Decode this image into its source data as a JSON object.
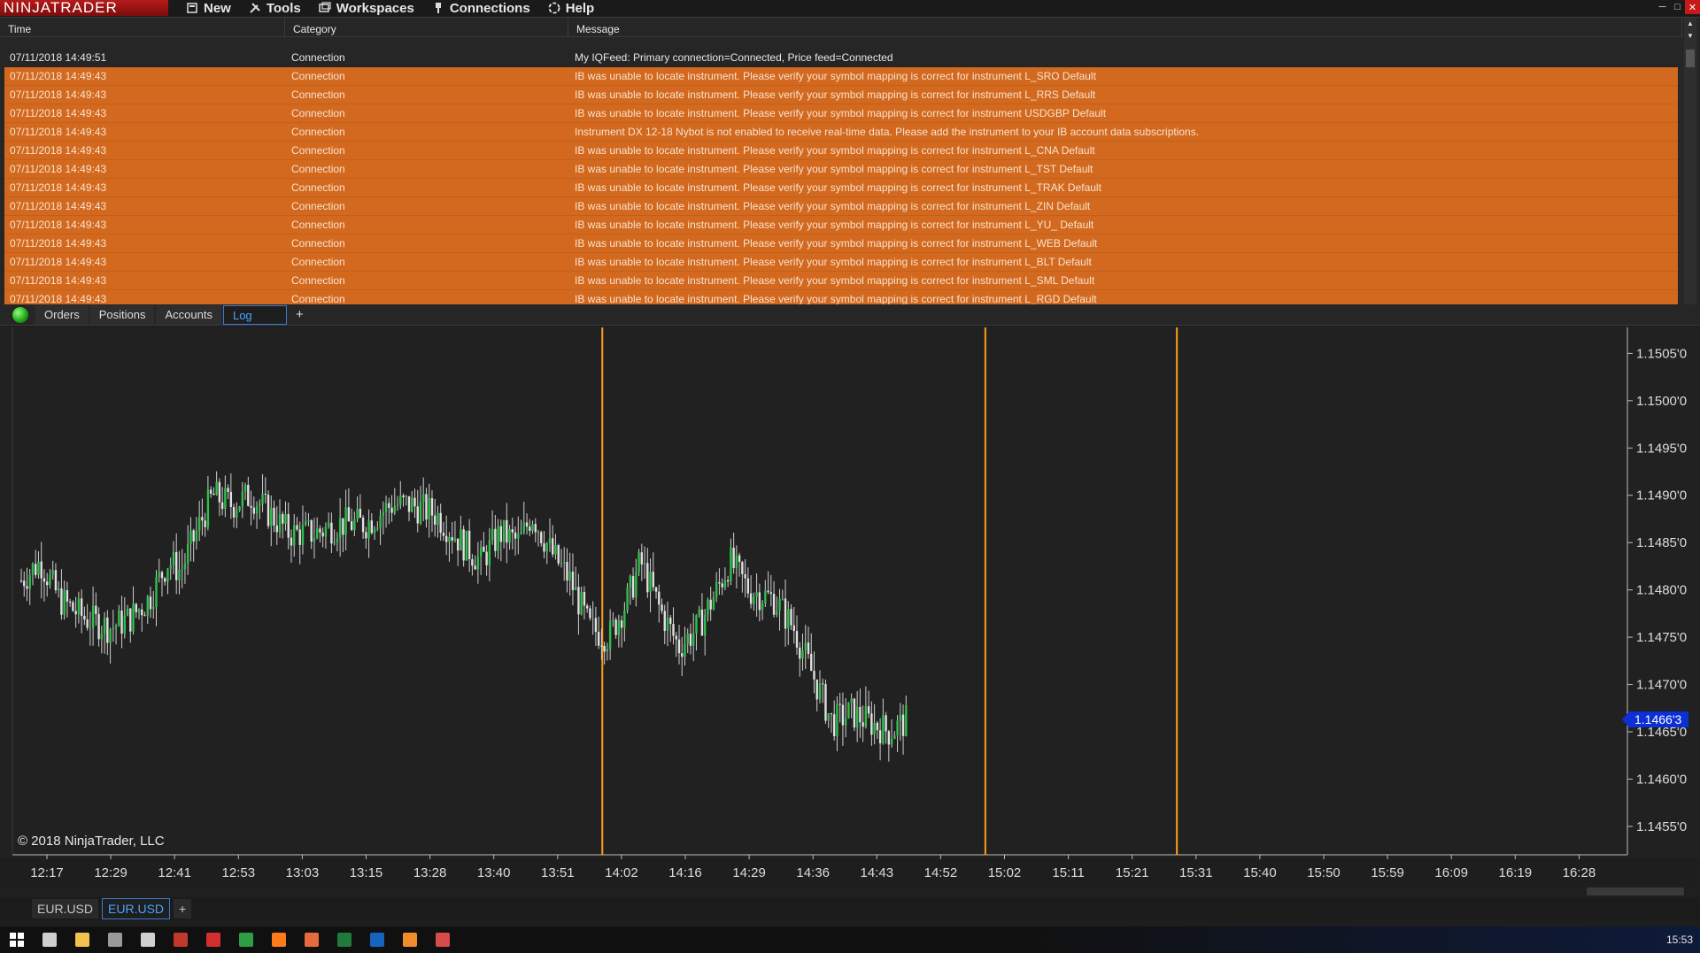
{
  "app": {
    "logo": "NINJATRADER"
  },
  "menu": [
    {
      "label": "New",
      "icon": "new-icon"
    },
    {
      "label": "Tools",
      "icon": "tools-icon"
    },
    {
      "label": "Workspaces",
      "icon": "workspaces-icon"
    },
    {
      "label": "Connections",
      "icon": "connections-icon"
    },
    {
      "label": "Help",
      "icon": "help-icon"
    }
  ],
  "log": {
    "headers": {
      "time": "Time",
      "category": "Category",
      "message": "Message"
    },
    "rows": [
      {
        "time": "07/11/2018 14:49:51",
        "category": "Connection",
        "message": "My IQFeed: Primary connection=Connected, Price feed=Connected",
        "level": "normal"
      },
      {
        "time": "07/11/2018 14:49:43",
        "category": "Connection",
        "message": "IB was unable to locate instrument. Please verify your symbol mapping is correct for instrument L_SRO Default",
        "level": "warn"
      },
      {
        "time": "07/11/2018 14:49:43",
        "category": "Connection",
        "message": "IB was unable to locate instrument. Please verify your symbol mapping is correct for instrument L_RRS Default",
        "level": "warn"
      },
      {
        "time": "07/11/2018 14:49:43",
        "category": "Connection",
        "message": "IB was unable to locate instrument. Please verify your symbol mapping is correct for instrument USDGBP Default",
        "level": "warn"
      },
      {
        "time": "07/11/2018 14:49:43",
        "category": "Connection",
        "message": "Instrument DX 12-18 Nybot is not enabled to receive real-time data. Please add the instrument to your IB account data subscriptions.",
        "level": "warn"
      },
      {
        "time": "07/11/2018 14:49:43",
        "category": "Connection",
        "message": "IB was unable to locate instrument. Please verify your symbol mapping is correct for instrument L_CNA Default",
        "level": "warn"
      },
      {
        "time": "07/11/2018 14:49:43",
        "category": "Connection",
        "message": "IB was unable to locate instrument. Please verify your symbol mapping is correct for instrument L_TST Default",
        "level": "warn"
      },
      {
        "time": "07/11/2018 14:49:43",
        "category": "Connection",
        "message": "IB was unable to locate instrument. Please verify your symbol mapping is correct for instrument L_TRAK Default",
        "level": "warn"
      },
      {
        "time": "07/11/2018 14:49:43",
        "category": "Connection",
        "message": "IB was unable to locate instrument. Please verify your symbol mapping is correct for instrument L_ZIN Default",
        "level": "warn"
      },
      {
        "time": "07/11/2018 14:49:43",
        "category": "Connection",
        "message": "IB was unable to locate instrument. Please verify your symbol mapping is correct for instrument L_YU_ Default",
        "level": "warn"
      },
      {
        "time": "07/11/2018 14:49:43",
        "category": "Connection",
        "message": "IB was unable to locate instrument. Please verify your symbol mapping is correct for instrument L_WEB Default",
        "level": "warn"
      },
      {
        "time": "07/11/2018 14:49:43",
        "category": "Connection",
        "message": "IB was unable to locate instrument. Please verify your symbol mapping is correct for instrument L_BLT Default",
        "level": "warn"
      },
      {
        "time": "07/11/2018 14:49:43",
        "category": "Connection",
        "message": "IB was unable to locate instrument. Please verify your symbol mapping is correct for instrument L_SML Default",
        "level": "warn"
      },
      {
        "time": "07/11/2018 14:49:43",
        "category": "Connection",
        "message": "IB was unable to locate instrument. Please verify your symbol mapping is correct for instrument L_RGD Default",
        "level": "warn"
      }
    ]
  },
  "log_tabs": {
    "items": [
      "Orders",
      "Positions",
      "Accounts",
      "Log"
    ],
    "active": "Log",
    "add": "+"
  },
  "chart_data": {
    "type": "candlestick",
    "instrument": "EUR.USD",
    "x_ticks": [
      "12:17",
      "12:29",
      "12:41",
      "12:53",
      "13:03",
      "13:15",
      "13:28",
      "13:40",
      "13:51",
      "14:02",
      "14:16",
      "14:29",
      "14:36",
      "14:43",
      "14:52",
      "15:02",
      "15:11",
      "15:21",
      "15:31",
      "15:40",
      "15:50",
      "15:59",
      "16:09",
      "16:19",
      "16:28"
    ],
    "y_ticks": [
      "1.1505'0",
      "1.1500'0",
      "1.1495'0",
      "1.1490'0",
      "1.1485'0",
      "1.1480'0",
      "1.1475'0",
      "1.1470'0",
      "1.1465'0",
      "1.1460'0",
      "1.1455'0"
    ],
    "ylim": [
      1.1452,
      1.1507
    ],
    "last_price": 1.14663,
    "last_price_label": "1.1466'3",
    "session_lines_after_tick": [
      "13:51",
      "14:52",
      "15:21"
    ],
    "close_path": [
      {
        "tick": 0.0,
        "price": 1.1481
      },
      {
        "tick": 0.3,
        "price": 1.1483
      },
      {
        "tick": 0.6,
        "price": 1.1479
      },
      {
        "tick": 1.0,
        "price": 1.1477
      },
      {
        "tick": 1.4,
        "price": 1.1476
      },
      {
        "tick": 1.7,
        "price": 1.1477
      },
      {
        "tick": 2.0,
        "price": 1.1479
      },
      {
        "tick": 2.3,
        "price": 1.1483
      },
      {
        "tick": 2.5,
        "price": 1.1482
      },
      {
        "tick": 2.8,
        "price": 1.1487
      },
      {
        "tick": 3.0,
        "price": 1.149
      },
      {
        "tick": 3.3,
        "price": 1.1489
      },
      {
        "tick": 3.6,
        "price": 1.149
      },
      {
        "tick": 3.9,
        "price": 1.1488
      },
      {
        "tick": 4.2,
        "price": 1.1486
      },
      {
        "tick": 4.6,
        "price": 1.1486
      },
      {
        "tick": 5.0,
        "price": 1.1487
      },
      {
        "tick": 5.4,
        "price": 1.1487
      },
      {
        "tick": 5.8,
        "price": 1.1489
      },
      {
        "tick": 6.1,
        "price": 1.1489
      },
      {
        "tick": 6.5,
        "price": 1.1488
      },
      {
        "tick": 6.9,
        "price": 1.1485
      },
      {
        "tick": 7.2,
        "price": 1.1483
      },
      {
        "tick": 7.5,
        "price": 1.1486
      },
      {
        "tick": 7.8,
        "price": 1.1485
      },
      {
        "tick": 8.0,
        "price": 1.1488
      },
      {
        "tick": 8.3,
        "price": 1.1484
      },
      {
        "tick": 8.6,
        "price": 1.1481
      },
      {
        "tick": 8.9,
        "price": 1.1476
      },
      {
        "tick": 9.2,
        "price": 1.1475
      },
      {
        "tick": 9.5,
        "price": 1.1479
      },
      {
        "tick": 9.7,
        "price": 1.1483
      },
      {
        "tick": 10.0,
        "price": 1.1478
      },
      {
        "tick": 10.3,
        "price": 1.1474
      },
      {
        "tick": 10.6,
        "price": 1.1476
      },
      {
        "tick": 10.9,
        "price": 1.148
      },
      {
        "tick": 11.1,
        "price": 1.1483
      },
      {
        "tick": 11.4,
        "price": 1.148
      },
      {
        "tick": 11.8,
        "price": 1.1479
      },
      {
        "tick": 12.1,
        "price": 1.1476
      },
      {
        "tick": 12.4,
        "price": 1.1471
      },
      {
        "tick": 12.7,
        "price": 1.1466
      },
      {
        "tick": 13.0,
        "price": 1.1467
      },
      {
        "tick": 13.3,
        "price": 1.1466
      },
      {
        "tick": 13.6,
        "price": 1.1465
      },
      {
        "tick": 13.9,
        "price": 1.14663
      }
    ]
  },
  "chart": {
    "copyright": "© 2018 NinjaTrader, LLC"
  },
  "chart_tabs": {
    "items": [
      "EUR.USD",
      "EUR.USD"
    ],
    "active_index": 1,
    "add": "+"
  },
  "taskbar": {
    "clock": "15:53",
    "icons": [
      {
        "name": "windows-start-icon",
        "color": "#ffffff"
      },
      {
        "name": "task-view-icon",
        "color": "#cfcfcf"
      },
      {
        "name": "file-explorer-icon",
        "color": "#f2c14e"
      },
      {
        "name": "terminal-icon",
        "color": "#9a9a9a"
      },
      {
        "name": "calculator-icon",
        "color": "#d0d0d0"
      },
      {
        "name": "ninjatrader-icon",
        "color": "#c0392b"
      },
      {
        "name": "acrobat-icon",
        "color": "#d32f2f"
      },
      {
        "name": "sierra-chart-icon",
        "color": "#2e9e44"
      },
      {
        "name": "firefox-icon",
        "color": "#ff7a1a"
      },
      {
        "name": "app-icon",
        "color": "#e56b3c"
      },
      {
        "name": "excel-icon",
        "color": "#1f7a3c"
      },
      {
        "name": "outlook-icon",
        "color": "#1565c0"
      },
      {
        "name": "app-2-icon",
        "color": "#f08c2a"
      },
      {
        "name": "app-3-icon",
        "color": "#d84b4b"
      }
    ]
  },
  "colors": {
    "warn_row": "#d2691e",
    "bull_candle": "#2fbf4a",
    "bear_candle": "#e0e0e0",
    "session_line": "#ff9e1b",
    "price_tag": "#0d2fd6"
  }
}
